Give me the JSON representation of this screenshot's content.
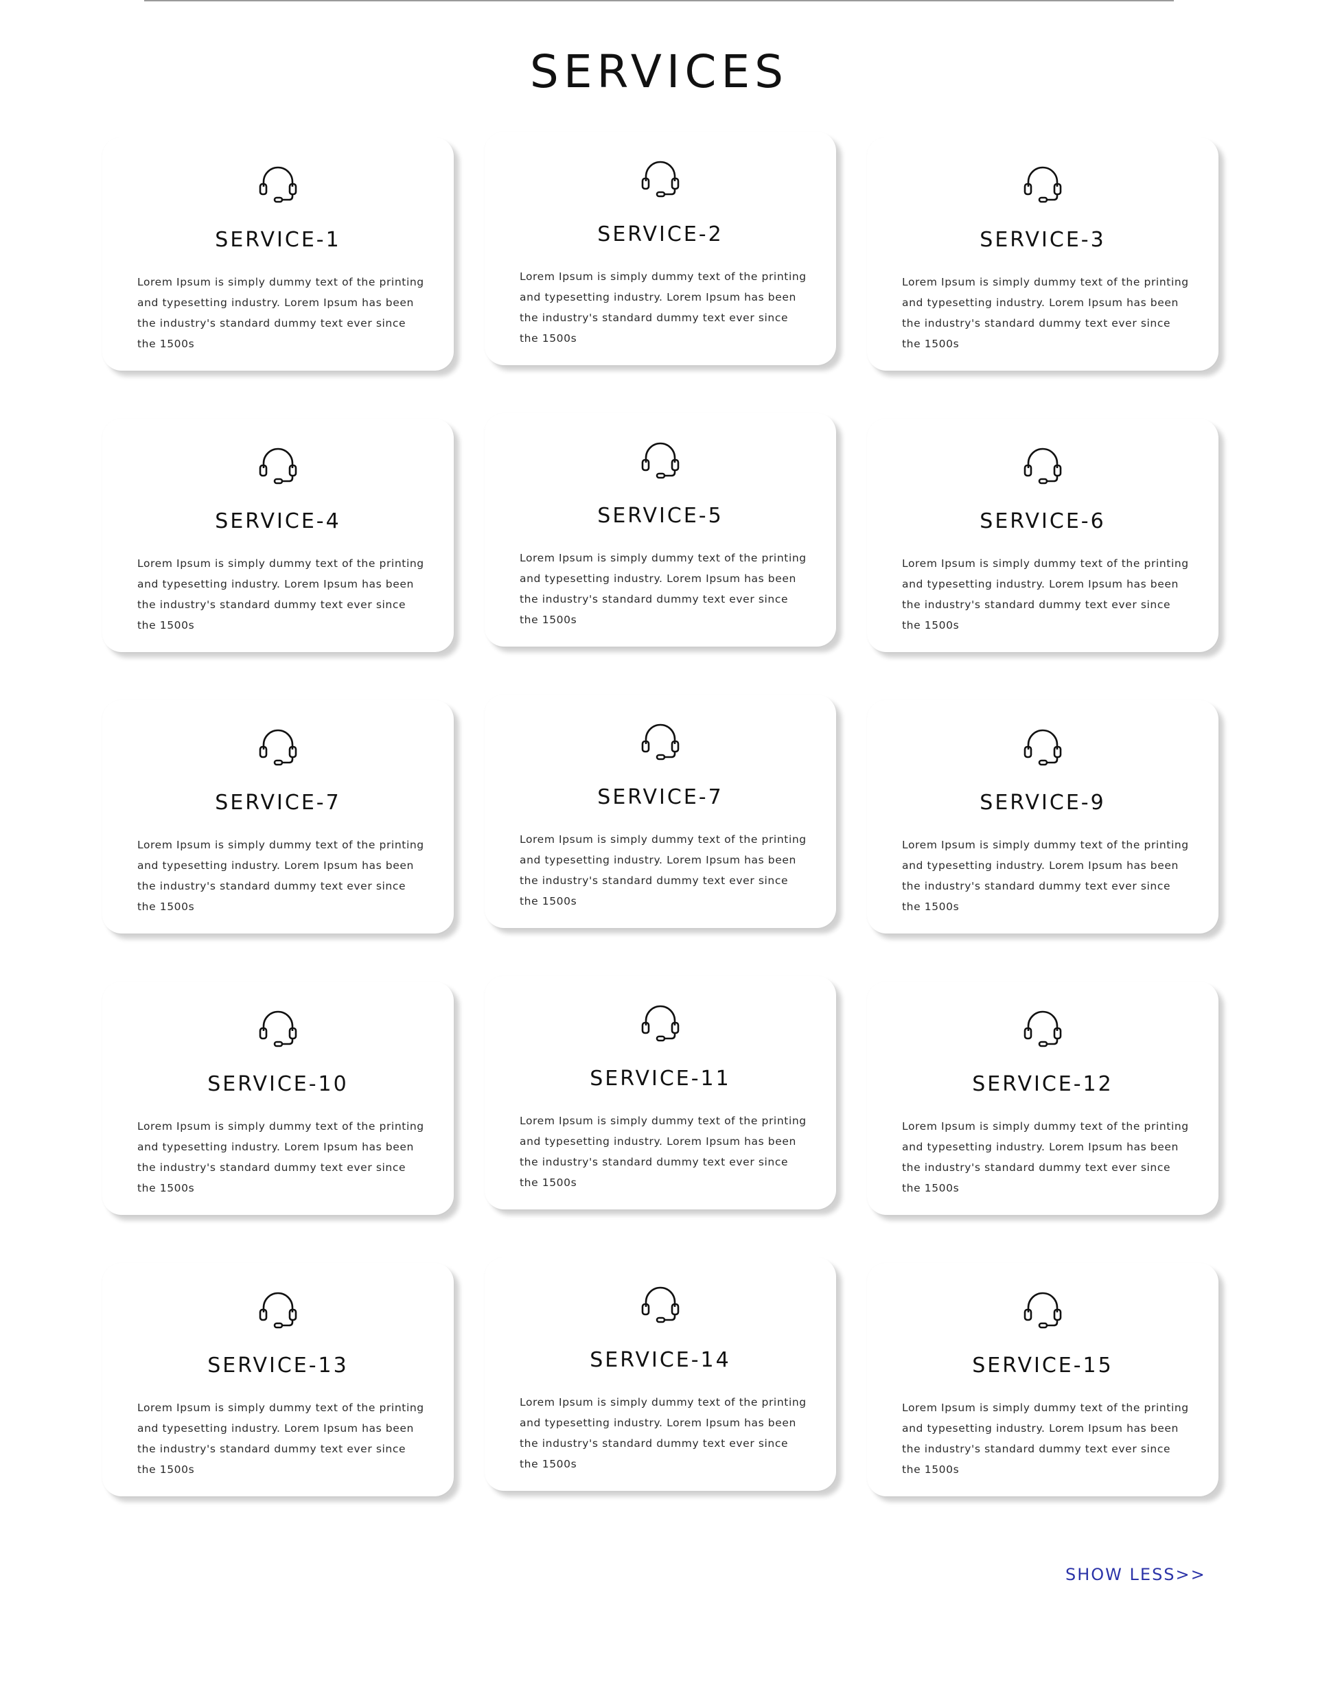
{
  "page": {
    "title": "SERVICES",
    "show_less_label": "SHOW LESS>>"
  },
  "icon": "headset-icon",
  "colors": {
    "link": "#2b33a8",
    "card_background": "#ffffff",
    "text": "#111111"
  },
  "services": [
    {
      "title": "SERVICE-1",
      "text": "Lorem Ipsum is simply dummy text of the printing and typesetting industry. Lorem Ipsum has been the industry's standard dummy text ever since the 1500s"
    },
    {
      "title": "SERVICE-2",
      "text": "Lorem Ipsum is simply dummy text of the printing and typesetting industry. Lorem Ipsum has been the industry's standard dummy text ever since the 1500s"
    },
    {
      "title": "SERVICE-3",
      "text": "Lorem Ipsum is simply dummy text of the printing and typesetting industry. Lorem Ipsum has been the industry's standard dummy text ever since the 1500s"
    },
    {
      "title": "SERVICE-4",
      "text": "Lorem Ipsum is simply dummy text of the printing and typesetting industry. Lorem Ipsum has been the industry's standard dummy text ever since the 1500s"
    },
    {
      "title": "SERVICE-5",
      "text": "Lorem Ipsum is simply dummy text of the printing and typesetting industry. Lorem Ipsum has been the industry's standard dummy text ever since the 1500s"
    },
    {
      "title": "SERVICE-6",
      "text": "Lorem Ipsum is simply dummy text of the printing and typesetting industry. Lorem Ipsum has been the industry's standard dummy text ever since the 1500s"
    },
    {
      "title": "SERVICE-7",
      "text": "Lorem Ipsum is simply dummy text of the printing and typesetting industry. Lorem Ipsum has been the industry's standard dummy text ever since the 1500s"
    },
    {
      "title": "SERVICE-7",
      "text": "Lorem Ipsum is simply dummy text of the printing and typesetting industry. Lorem Ipsum has been the industry's standard dummy text ever since the 1500s"
    },
    {
      "title": "SERVICE-9",
      "text": "Lorem Ipsum is simply dummy text of the printing and typesetting industry. Lorem Ipsum has been the industry's standard dummy text ever since the 1500s"
    },
    {
      "title": "SERVICE-10",
      "text": "Lorem Ipsum is simply dummy text of the printing and typesetting industry. Lorem Ipsum has been the industry's standard dummy text ever since the 1500s"
    },
    {
      "title": "SERVICE-11",
      "text": "Lorem Ipsum is simply dummy text of the printing and typesetting industry. Lorem Ipsum has been the industry's standard dummy text ever since the 1500s"
    },
    {
      "title": "SERVICE-12",
      "text": "Lorem Ipsum is simply dummy text of the printing and typesetting industry. Lorem Ipsum has been the industry's standard dummy text ever since the 1500s"
    },
    {
      "title": "SERVICE-13",
      "text": "Lorem Ipsum is simply dummy text of the printing and typesetting industry. Lorem Ipsum has been the industry's standard dummy text ever since the 1500s"
    },
    {
      "title": "SERVICE-14",
      "text": "Lorem Ipsum is simply dummy text of the printing and typesetting industry. Lorem Ipsum has been the industry's standard dummy text ever since the 1500s"
    },
    {
      "title": "SERVICE-15",
      "text": "Lorem Ipsum is simply dummy text of the printing and typesetting industry. Lorem Ipsum has been the industry's standard dummy text ever since the 1500s"
    }
  ]
}
